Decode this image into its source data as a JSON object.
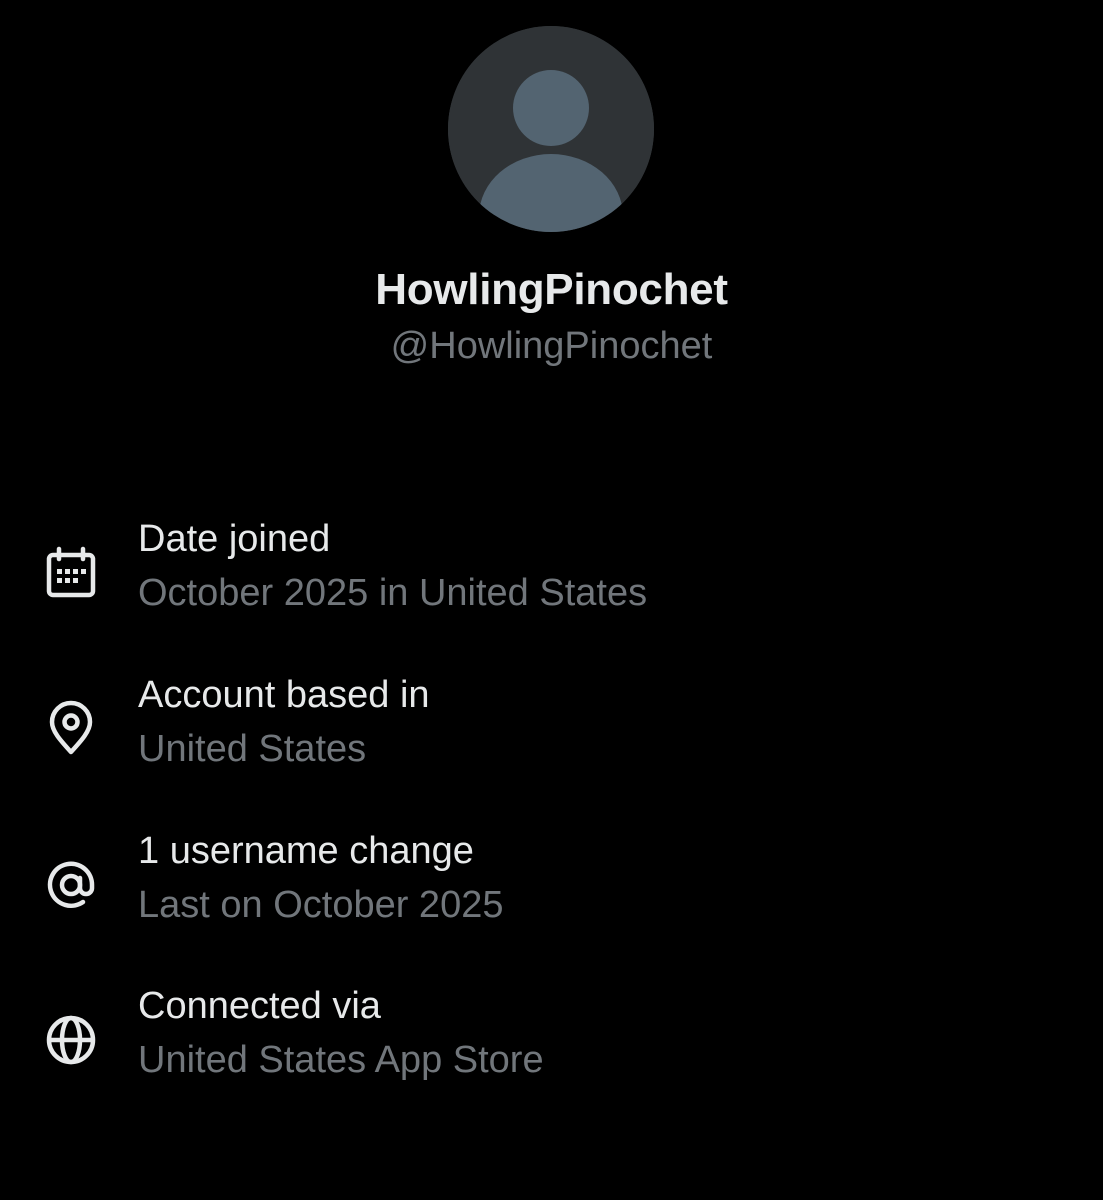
{
  "profile": {
    "display_name": "HowlingPinochet",
    "handle": "@HowlingPinochet"
  },
  "info": [
    {
      "icon": "calendar-icon",
      "title": "Date joined",
      "value": "October 2025 in United States"
    },
    {
      "icon": "location-pin-icon",
      "title": "Account based in",
      "value": "United States"
    },
    {
      "icon": "at-sign-icon",
      "title": "1 username change",
      "value": "Last on October 2025"
    },
    {
      "icon": "globe-icon",
      "title": "Connected via",
      "value": "United States App Store"
    }
  ],
  "colors": {
    "background": "#000000",
    "primary_text": "#e7e9ea",
    "secondary_text": "#71767b"
  }
}
